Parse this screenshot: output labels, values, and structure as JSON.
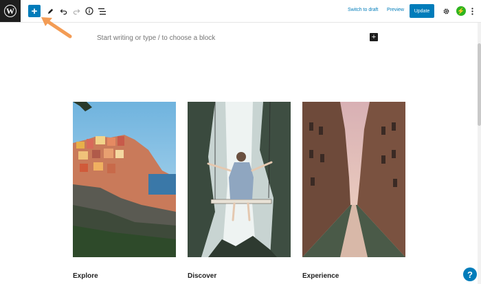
{
  "toolbar": {
    "logo_letter": "W",
    "add_symbol": "+",
    "switch_to_draft": "Switch to draft",
    "preview": "Preview",
    "update": "Update",
    "jetpack_letter": "⚡"
  },
  "editor": {
    "placeholder": "Start writing or type / to choose a block",
    "inline_add_symbol": "+"
  },
  "columns": [
    {
      "title": "Explore",
      "image": "coastal-village-photo"
    },
    {
      "title": "Discover",
      "image": "waterfall-swing-photo"
    },
    {
      "title": "Experience",
      "image": "venice-canal-photo"
    }
  ],
  "help_symbol": "?",
  "colors": {
    "accent": "#007cba",
    "arrow": "#f39c55",
    "dark": "#1e1e1e"
  }
}
